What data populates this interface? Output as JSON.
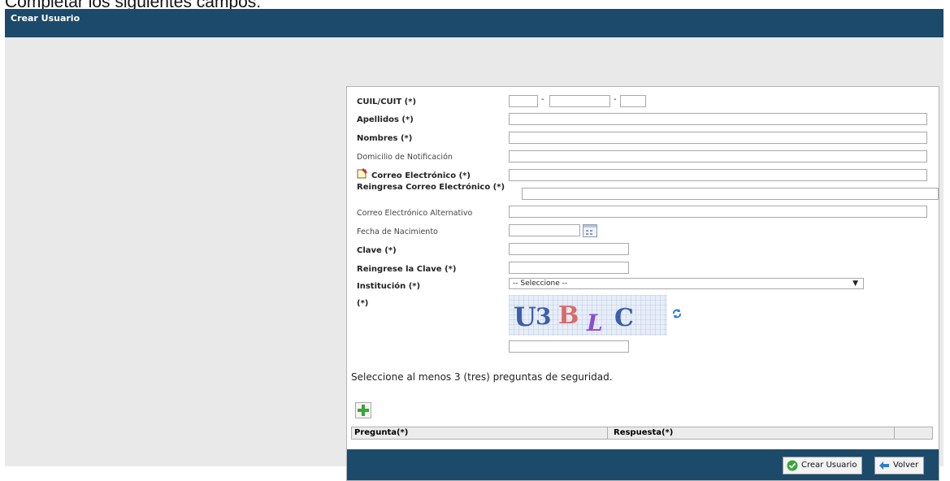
{
  "caption": "Completar los siguientes campos:",
  "window": {
    "title": "Crear Usuario"
  },
  "form": {
    "cuil_label": "CUIL/CUIT (*)",
    "cuil_sep": "-",
    "apellidos_label": "Apellidos (*)",
    "nombres_label": "Nombres (*)",
    "domicilio_label": "Domicilio de Notificación",
    "correo_label": "Correo Electrónico (*)",
    "reingresa_correo_label": "Reingresa Correo Electrónico (*)",
    "correo_alt_label": "Correo Electrónico Alternativo",
    "fecha_label": "Fecha de Nacimiento",
    "clave_label": "Clave (*)",
    "reingrese_clave_label": "Reingrese la Clave (*)",
    "institucion_label": "Institución (*)",
    "institucion_selected": "-- Seleccione --",
    "captcha_label": "(*)",
    "captcha_text": "U3BLC"
  },
  "security": {
    "instruction": "Seleccione al menos 3 (tres) preguntas de seguridad.",
    "columns": [
      "Pregunta(*)",
      "Respuesta(*)"
    ]
  },
  "buttons": {
    "create": "Crear Usuario",
    "back": "Volver"
  },
  "colors": {
    "titlebar": "#1b4a6b",
    "add_icon": "#3aa53a"
  },
  "icons": {
    "edit": "edit-note-icon",
    "calendar": "calendar-icon",
    "refresh": "refresh-icon",
    "add": "plus-icon",
    "ok": "check-circle-icon",
    "back": "arrow-left-icon"
  }
}
